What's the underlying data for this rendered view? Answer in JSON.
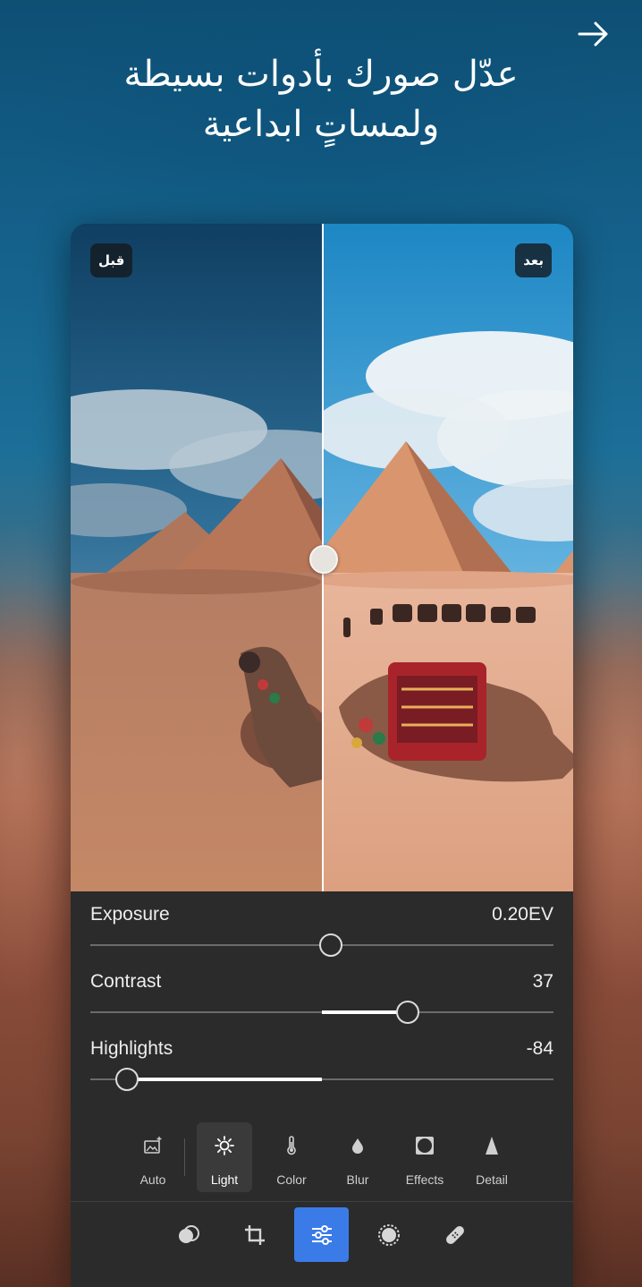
{
  "headline": {
    "line1": "عدّل صورك بأدوات بسيطة",
    "line2": "ولمساتٍ ابداعية"
  },
  "compare": {
    "before_label": "قبل",
    "after_label": "بعد"
  },
  "adjustments": [
    {
      "label": "Exposure",
      "value": "0.20EV",
      "position": 0.52,
      "fill_from": null
    },
    {
      "label": "Contrast",
      "value": "37",
      "position": 0.685,
      "fill_from": 0.5
    },
    {
      "label": "Highlights",
      "value": "-84",
      "position": 0.08,
      "fill_from": 0.5
    }
  ],
  "tools": [
    {
      "label": "Auto",
      "icon": "auto-photo-icon",
      "active": false
    },
    {
      "label": "Light",
      "icon": "sun-icon",
      "active": true
    },
    {
      "label": "Color",
      "icon": "thermometer-icon",
      "active": false
    },
    {
      "label": "Blur",
      "icon": "drop-icon",
      "active": false
    },
    {
      "label": "Effects",
      "icon": "vignette-icon",
      "active": false
    },
    {
      "label": "Detail",
      "icon": "triangle-icon",
      "active": false
    }
  ],
  "bottom_bar": [
    {
      "icon": "presets-icon",
      "active": false
    },
    {
      "icon": "crop-icon",
      "active": false
    },
    {
      "icon": "adjust-sliders-icon",
      "active": true
    },
    {
      "icon": "selective-icon",
      "active": false
    },
    {
      "icon": "healing-bandage-icon",
      "active": false
    }
  ],
  "colors": {
    "accent": "#3b7be8",
    "panel": "#2b2b2b"
  }
}
